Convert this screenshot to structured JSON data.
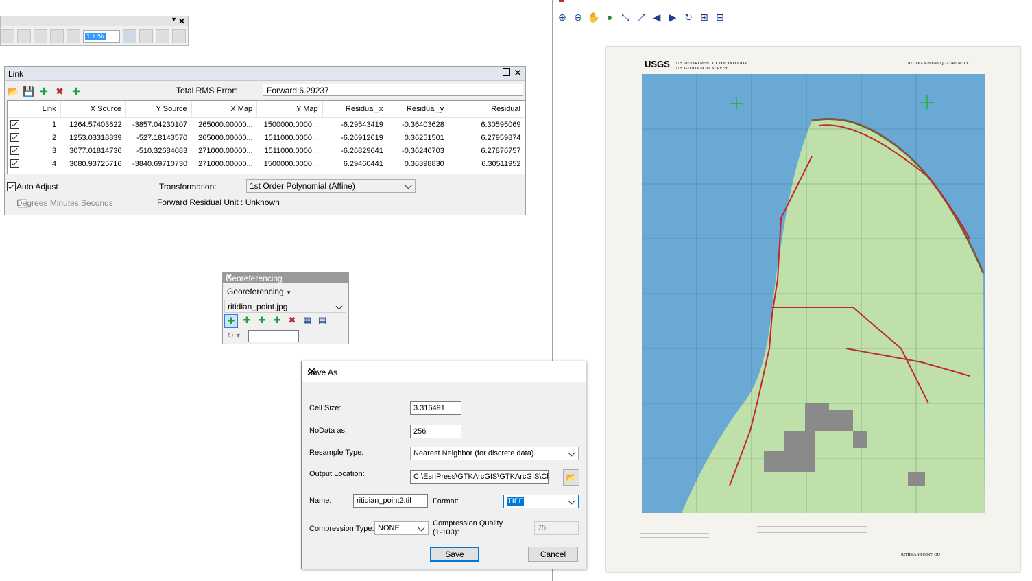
{
  "link": {
    "title": "Link",
    "rms_label": "Total RMS Error:",
    "rms_value": "Forward:6.29237",
    "columns": [
      "",
      "Link",
      "X Source",
      "Y Source",
      "X Map",
      "Y Map",
      "Residual_x",
      "Residual_y",
      "Residual"
    ],
    "rows": [
      {
        "link": "1",
        "xs": "1264.57403622",
        "ys": "-3857.04230107",
        "xm": "265000.00000...",
        "ym": "1500000.0000...",
        "rx": "-6.29543419",
        "ry": "-0.36403628",
        "r": "6.30595069"
      },
      {
        "link": "2",
        "xs": "1253.03318839",
        "ys": "-527.18143570",
        "xm": "265000.00000...",
        "ym": "1511000.0000...",
        "rx": "-6.26912619",
        "ry": "0.36251501",
        "r": "6.27959874"
      },
      {
        "link": "3",
        "xs": "3077.01814736",
        "ys": "-510.32684083",
        "xm": "271000.00000...",
        "ym": "1511000.0000...",
        "rx": "-6.26829641",
        "ry": "-0.36246703",
        "r": "6.27876757"
      },
      {
        "link": "4",
        "xs": "3080.93725716",
        "ys": "-3840.69710730",
        "xm": "271000.00000...",
        "ym": "1500000.0000...",
        "rx": "6.29460441",
        "ry": "0.36398830",
        "r": "6.30511952"
      }
    ],
    "auto_adjust": "Auto Adjust",
    "dms": "Degrees Minutes Seconds",
    "transformation_label": "Transformation:",
    "transformation_value": "1st Order Polynomial (Affine)",
    "residual_unit": "Forward Residual Unit : Unknown"
  },
  "toolbar": {
    "scale_value": "100%"
  },
  "geo": {
    "title": "Georeferencing",
    "menu": "Georeferencing",
    "layer": "ritidian_point.jpg"
  },
  "save": {
    "title": "Save As",
    "cell_size_label": "Cell Size:",
    "cell_size": "3.316491",
    "nodata_label": "NoData as:",
    "nodata": "256",
    "resample_label": "Resample Type:",
    "resample": "Nearest Neighbor (for discrete data)",
    "output_label": "Output Location:",
    "output": "C:\\EsriPress\\GTKArcGIS\\GTKArcGIS\\Cha",
    "name_label": "Name:",
    "name": "ritidian_point2.tif",
    "format_label": "Format:",
    "format": "TIFF",
    "compression_type_label": "Compression Type:",
    "compression_type": "NONE",
    "compression_quality_label_1": "Compression Quality",
    "compression_quality_label_2": "(1-100):",
    "compression_quality": "75",
    "save_btn": "Save",
    "cancel_btn": "Cancel"
  },
  "map": {
    "publisher": "USGS",
    "dept": "U.S. DEPARTMENT OF THE INTERIOR",
    "survey": "U.S. GEOLOGICAL SURVEY",
    "quad": "RITIDIAN POINT QUADRANGLE",
    "footer": "RITIDIAN POINT, GU",
    "colors": {
      "sea": "#6aa9d3",
      "land": "#bfe0a8",
      "boundary": "#c0282d",
      "urban": "#8a8a8a"
    }
  }
}
